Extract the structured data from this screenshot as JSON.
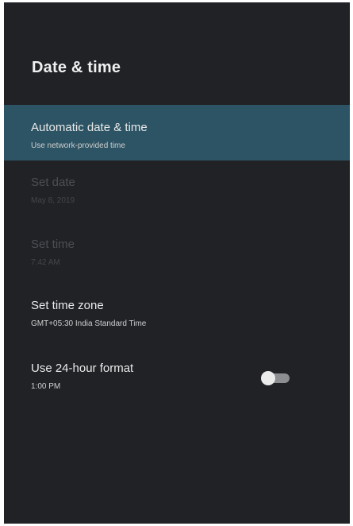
{
  "header": {
    "title": "Date & time"
  },
  "settings": [
    {
      "label": "Automatic date & time",
      "value": "Use network-provided time",
      "state": "selected"
    },
    {
      "label": "Set date",
      "value": "May 8, 2019",
      "state": "disabled"
    },
    {
      "label": "Set time",
      "value": "7:42 AM",
      "state": "disabled"
    },
    {
      "label": "Set time zone",
      "value": "GMT+05:30 India Standard Time",
      "state": "enabled"
    },
    {
      "label": "Use 24-hour format",
      "value": "1:00 PM",
      "state": "enabled",
      "toggle_on": false
    }
  ],
  "colors": {
    "background": "#202226",
    "selected_highlight": "#2d5464",
    "disabled_text": "#4b4e53"
  }
}
